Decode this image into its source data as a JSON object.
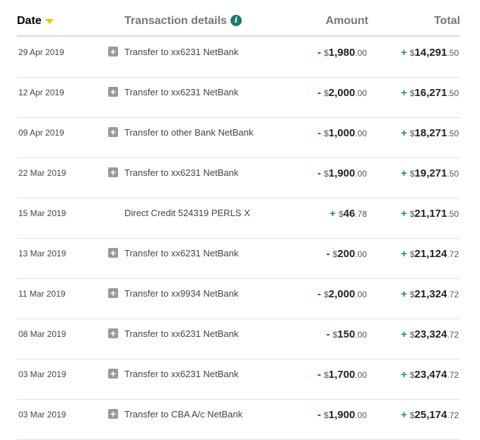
{
  "header": {
    "date": "Date",
    "details": "Transaction details",
    "info": "i",
    "amount": "Amount",
    "total": "Total"
  },
  "currency": "$",
  "expand_glyph": "+",
  "transactions": [
    {
      "date": "29 Apr 2019",
      "desc": "Transfer to xx6231 NetBank",
      "amount_sign": "-",
      "amount_dollars": "1,980",
      "amount_cents": ".00",
      "total_sign": "+",
      "total_dollars": "14,291",
      "total_cents": ".50"
    },
    {
      "date": "12 Apr 2019",
      "desc": "Transfer to xx6231 NetBank",
      "amount_sign": "-",
      "amount_dollars": "2,000",
      "amount_cents": ".00",
      "total_sign": "+",
      "total_dollars": "16,271",
      "total_cents": ".50"
    },
    {
      "date": "09 Apr 2019",
      "desc": "Transfer to other Bank NetBank",
      "amount_sign": "-",
      "amount_dollars": "1,000",
      "amount_cents": ".00",
      "total_sign": "+",
      "total_dollars": "18,271",
      "total_cents": ".50"
    },
    {
      "date": "22 Mar 2019",
      "desc": "Transfer to xx6231 NetBank",
      "amount_sign": "-",
      "amount_dollars": "1,900",
      "amount_cents": ".00",
      "total_sign": "+",
      "total_dollars": "19,271",
      "total_cents": ".50"
    },
    {
      "date": "15 Mar 2019",
      "desc": "Direct Credit 524319 PERLS X",
      "amount_sign": "+",
      "amount_dollars": "46",
      "amount_cents": ".78",
      "total_sign": "+",
      "total_dollars": "21,171",
      "total_cents": ".50"
    },
    {
      "date": "13 Mar 2019",
      "desc": "Transfer to xx6231 NetBank",
      "amount_sign": "-",
      "amount_dollars": "200",
      "amount_cents": ".00",
      "total_sign": "+",
      "total_dollars": "21,124",
      "total_cents": ".72"
    },
    {
      "date": "11 Mar 2019",
      "desc": "Transfer to xx9934 NetBank",
      "amount_sign": "-",
      "amount_dollars": "2,000",
      "amount_cents": ".00",
      "total_sign": "+",
      "total_dollars": "21,324",
      "total_cents": ".72"
    },
    {
      "date": "08 Mar 2019",
      "desc": "Transfer to xx6231 NetBank",
      "amount_sign": "-",
      "amount_dollars": "150",
      "amount_cents": ".00",
      "total_sign": "+",
      "total_dollars": "23,324",
      "total_cents": ".72"
    },
    {
      "date": "03 Mar 2019",
      "desc": "Transfer to xx6231 NetBank",
      "amount_sign": "-",
      "amount_dollars": "1,700",
      "amount_cents": ".00",
      "total_sign": "+",
      "total_dollars": "23,474",
      "total_cents": ".72"
    },
    {
      "date": "03 Mar 2019",
      "desc": "Transfer to CBA A/c NetBank",
      "amount_sign": "-",
      "amount_dollars": "1,900",
      "amount_cents": ".00",
      "total_sign": "+",
      "total_dollars": "25,174",
      "total_cents": ".72"
    }
  ],
  "colors": {
    "debit": "#d0021b",
    "credit": "#1e9a3a",
    "sort_arrow": "#f6c100",
    "info_icon": "#1c7a6e"
  }
}
